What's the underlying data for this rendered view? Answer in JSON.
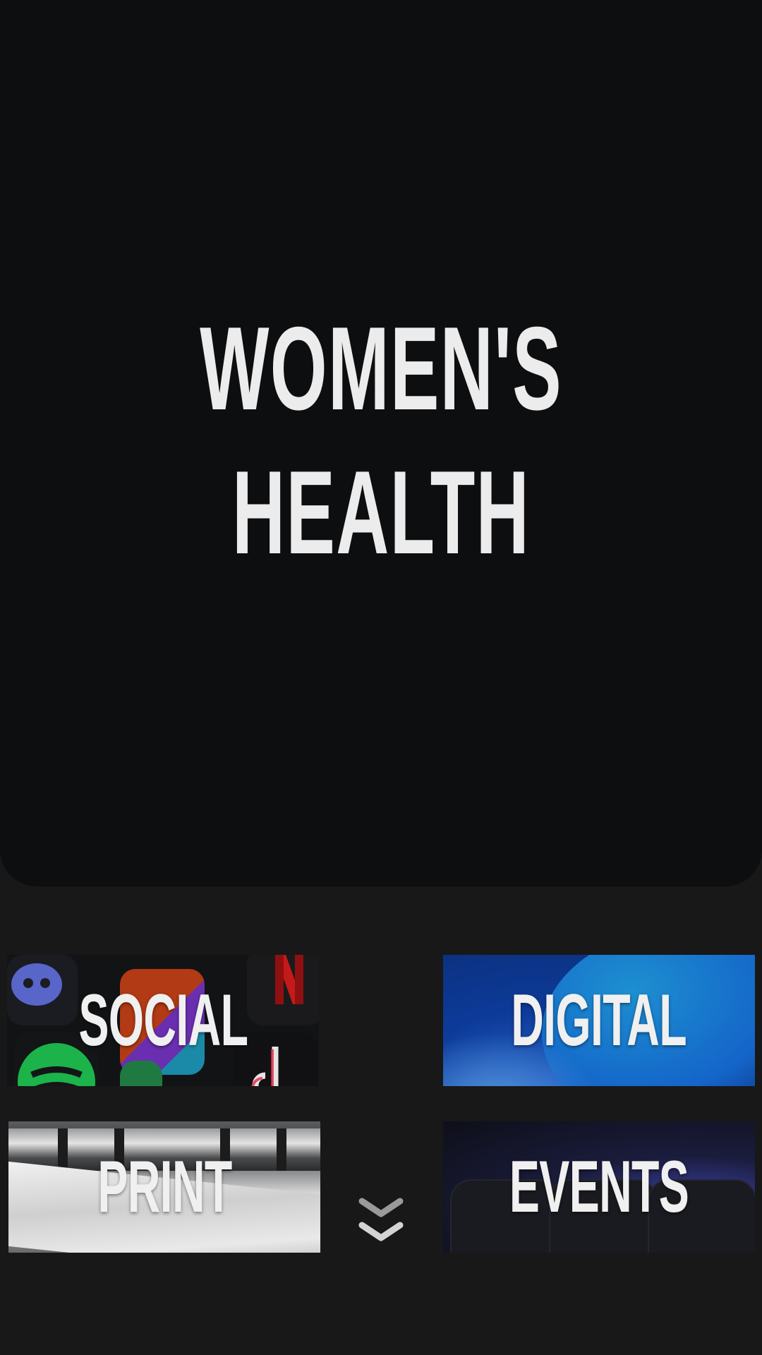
{
  "hero": {
    "title_line1": "WOMEN'S",
    "title_line2": "HEALTH"
  },
  "tiles": [
    {
      "label": "SOCIAL"
    },
    {
      "label": "DIGITAL"
    },
    {
      "label": "PRINT"
    },
    {
      "label": "EVENTS"
    }
  ],
  "scroll_hint": {
    "icon": "double-chevron-down-icon"
  },
  "colors": {
    "page_bg": "#181818",
    "hero_bg": "#0d0e10",
    "text": "#ececec",
    "digital_blue": "#0d3b9a"
  }
}
